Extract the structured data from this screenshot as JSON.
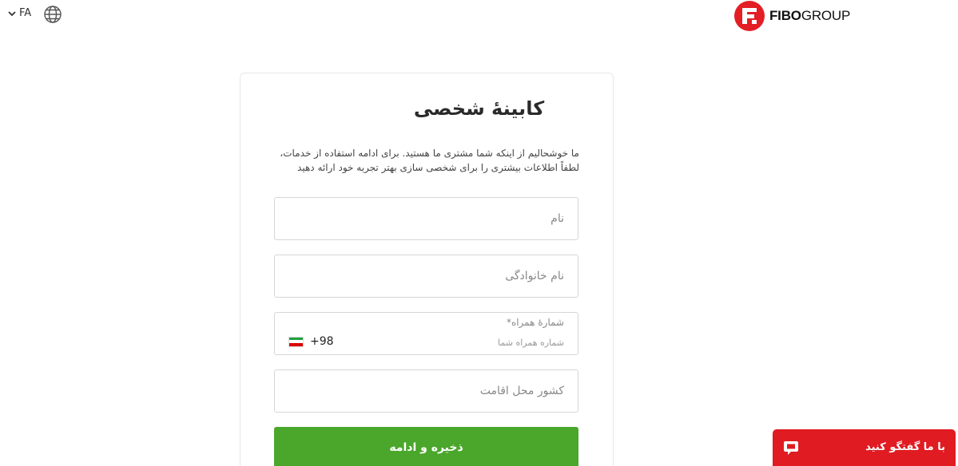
{
  "header": {
    "language_code": "FA",
    "brand_bold": "FIBO",
    "brand_light": "GROUP"
  },
  "form": {
    "title": "کابینۀ شخصی",
    "description": "ما خوشحالیم از اینکه شما مشتری ما هستید. برای ادامه استفاده از خدمات، لطفاً اطلاعات بیشتری را برای شخصی سازی بهتر تجربه خود ارائه دهید",
    "first_name_placeholder": "نام",
    "last_name_placeholder": "نام خانوادگی",
    "phone_label": "شمارۀ همراه*",
    "phone_placeholder": "شماره همراه شما",
    "dial_code": "+98",
    "country_placeholder": "کشور محل اقامت",
    "submit_label": "ذخیره و ادامه"
  },
  "chat": {
    "label": "با ما گفتگو کنید"
  },
  "colors": {
    "accent_green": "#4aa72b",
    "chat_red": "#e01b22",
    "brand_red": "#e31e24"
  },
  "icons": {
    "language_toggle": "chevron-down-icon",
    "globe": "globe-icon",
    "logo": "fibo-logo-icon",
    "flag": "iran-flag-icon",
    "chat": "chat-bubble-icon"
  }
}
